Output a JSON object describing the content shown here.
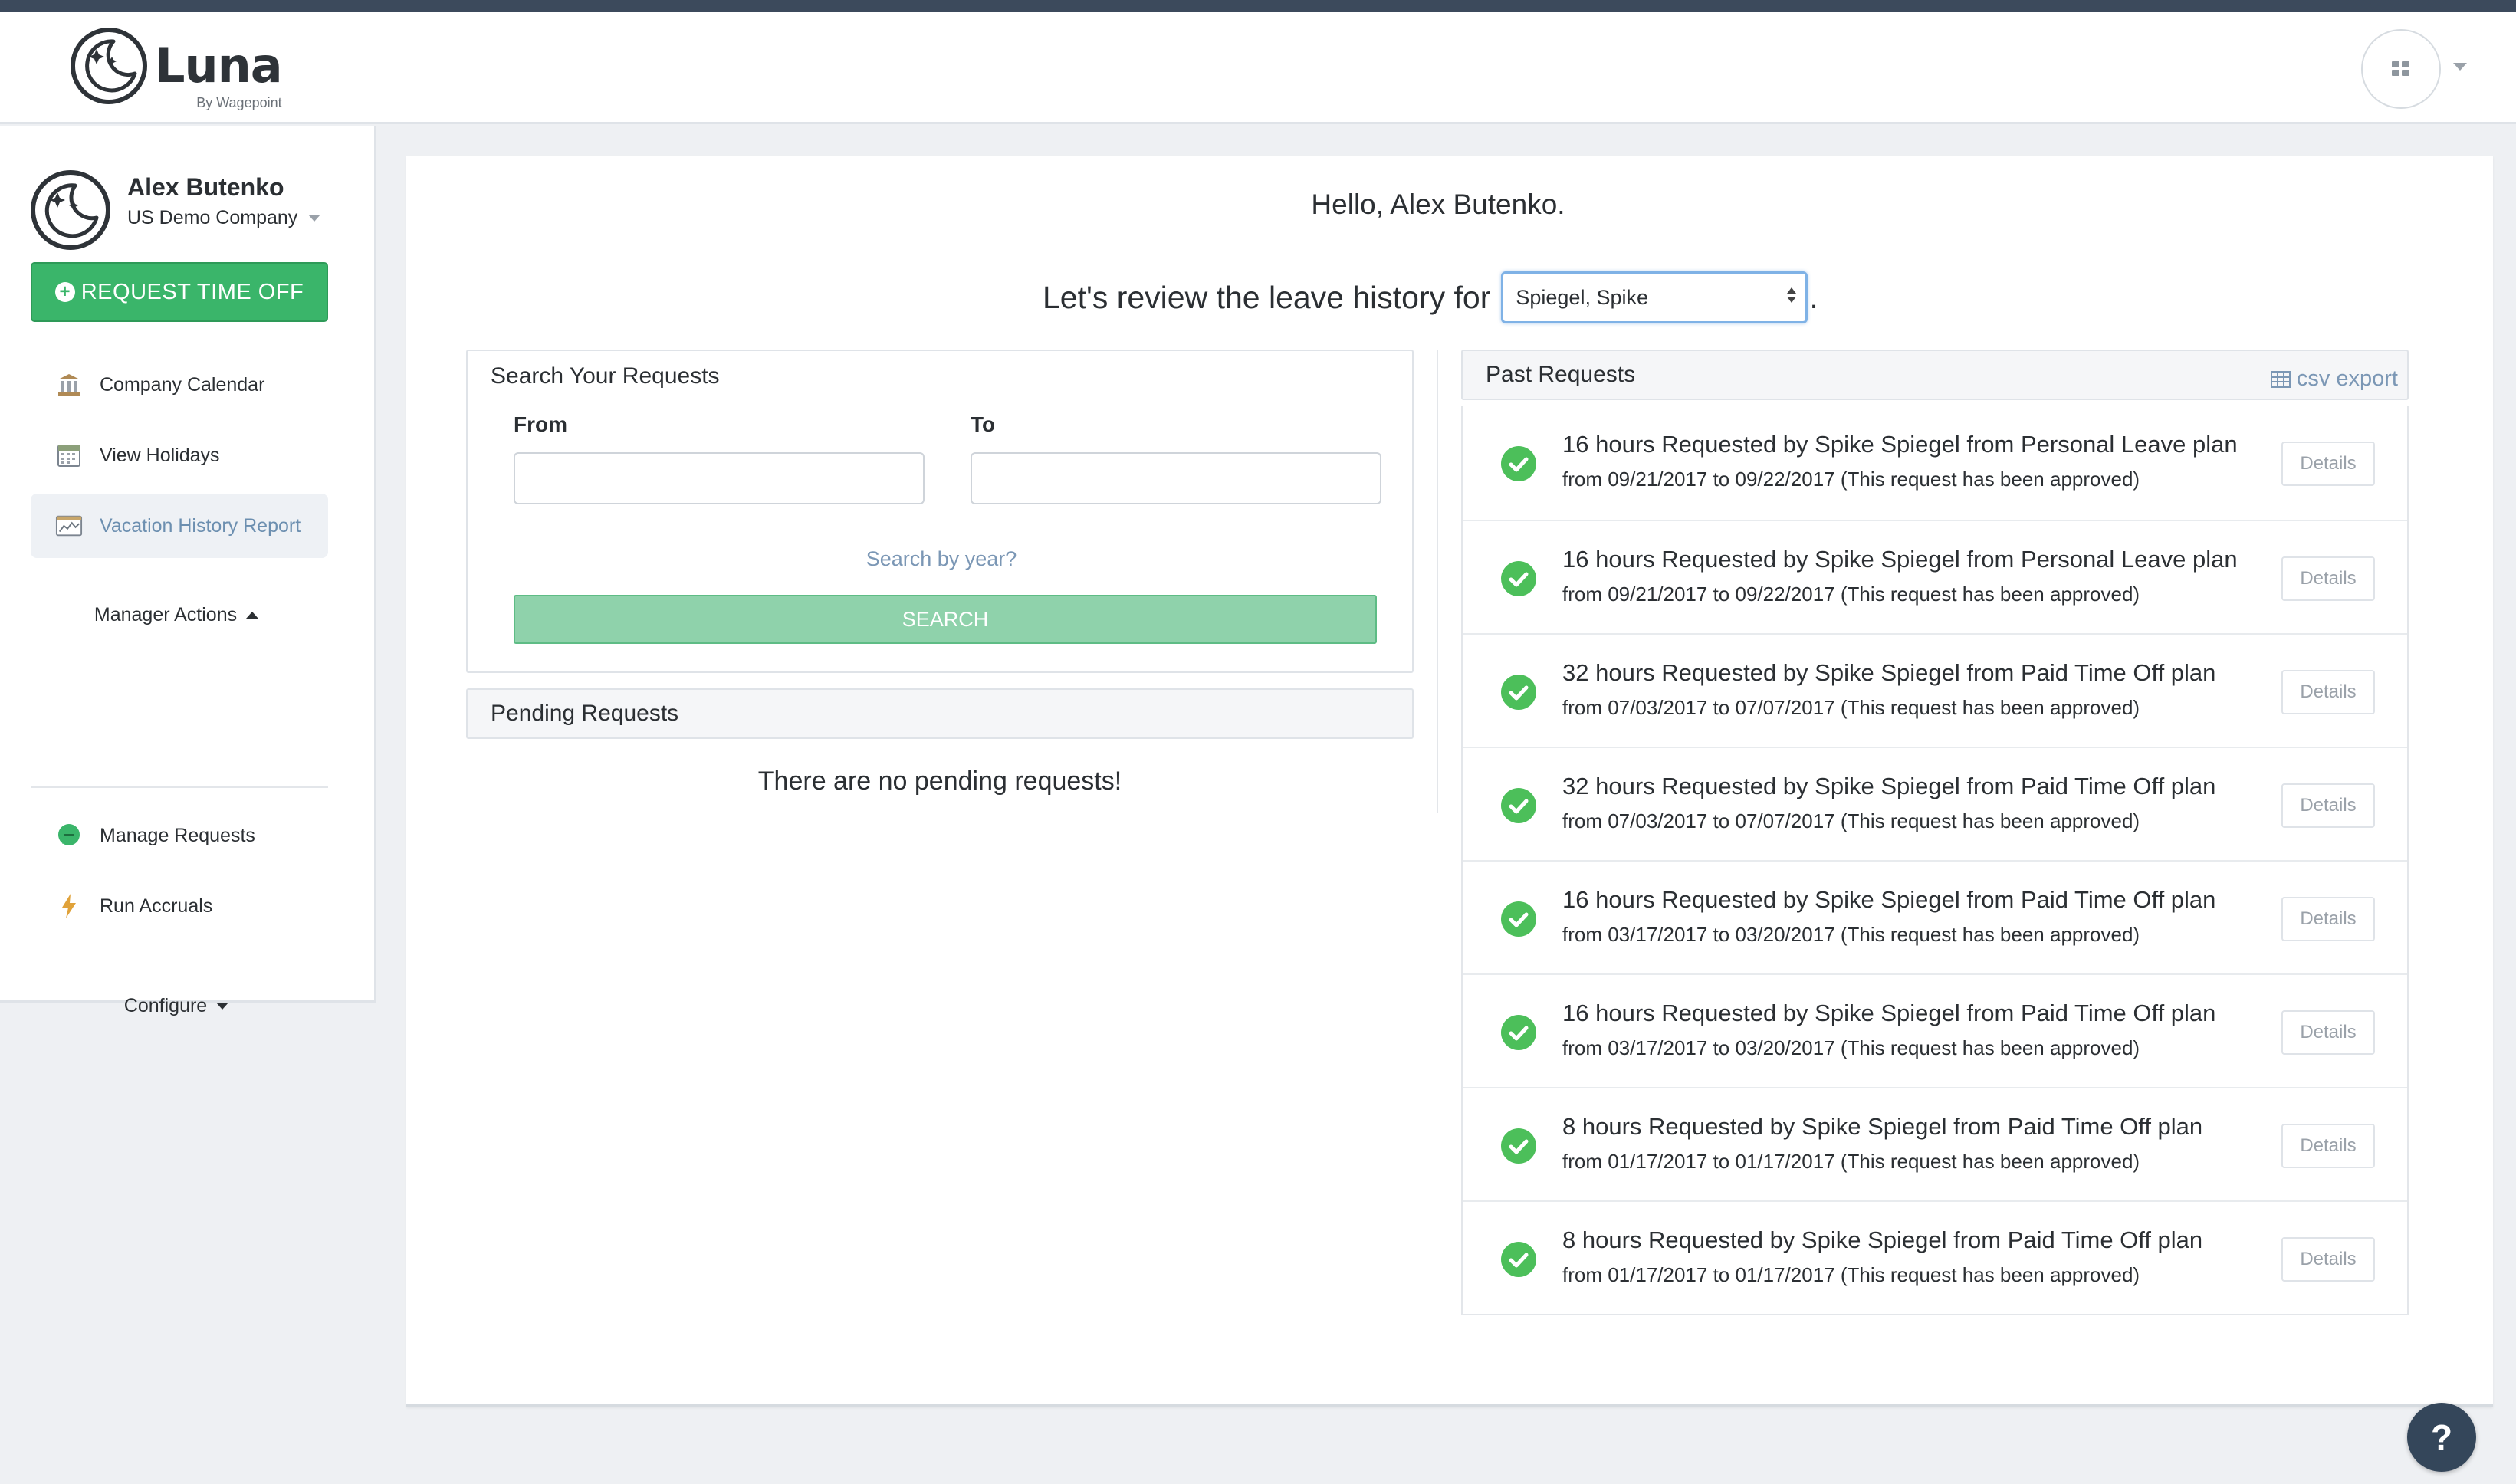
{
  "app": {
    "logo_name": "Luna",
    "logo_sub": "By Wagepoint"
  },
  "user": {
    "name": "Alex Butenko",
    "company": "US Demo Company"
  },
  "sidebar": {
    "request_button": "REQUEST TIME OFF",
    "items": [
      {
        "label": "Company Calendar",
        "icon": "bank-icon"
      },
      {
        "label": "View Holidays",
        "icon": "calendar-icon"
      },
      {
        "label": "Vacation History Report",
        "icon": "chart-icon"
      }
    ],
    "manager_actions_label": "Manager Actions",
    "manager_items": [
      {
        "label": "Manage Requests",
        "icon": "chat-icon"
      },
      {
        "label": "Run Accruals",
        "icon": "bolt-icon"
      }
    ],
    "configure_label": "Configure"
  },
  "main": {
    "greeting": "Hello, Alex Butenko.",
    "review_prefix": "Let's review the leave history for",
    "selected_employee": "Spiegel, Spike",
    "review_suffix": "."
  },
  "search": {
    "title": "Search Your Requests",
    "from_label": "From",
    "to_label": "To",
    "from_value": "",
    "to_value": "",
    "year_link": "Search by year?",
    "button": "SEARCH"
  },
  "pending": {
    "title": "Pending Requests",
    "empty_message": "There are no pending requests!"
  },
  "past": {
    "title": "Past Requests",
    "export_label": "csv export",
    "details_label": "Details",
    "requests": [
      {
        "title": "16 hours Requested by Spike Spiegel from Personal Leave plan",
        "sub": "from 09/21/2017 to 09/22/2017 (This request has been approved)"
      },
      {
        "title": "16 hours Requested by Spike Spiegel from Personal Leave plan",
        "sub": "from 09/21/2017 to 09/22/2017 (This request has been approved)"
      },
      {
        "title": "32 hours Requested by Spike Spiegel from Paid Time Off plan",
        "sub": "from 07/03/2017 to 07/07/2017 (This request has been approved)"
      },
      {
        "title": "32 hours Requested by Spike Spiegel from Paid Time Off plan",
        "sub": "from 07/03/2017 to 07/07/2017 (This request has been approved)"
      },
      {
        "title": "16 hours Requested by Spike Spiegel from Paid Time Off plan",
        "sub": "from 03/17/2017 to 03/20/2017 (This request has been approved)"
      },
      {
        "title": "16 hours Requested by Spike Spiegel from Paid Time Off plan",
        "sub": "from 03/17/2017 to 03/20/2017 (This request has been approved)"
      },
      {
        "title": "8 hours Requested by Spike Spiegel from Paid Time Off plan",
        "sub": "from 01/17/2017 to 01/17/2017 (This request has been approved)"
      },
      {
        "title": "8 hours Requested by Spike Spiegel from Paid Time Off plan",
        "sub": "from 01/17/2017 to 01/17/2017 (This request has been approved)"
      }
    ]
  },
  "help": {
    "label": "?"
  },
  "colors": {
    "primary_green": "#3ab56a",
    "search_green": "#8fd2ab",
    "link_blue": "#7b97b5",
    "top_stripe": "#3c4a5c",
    "help_button": "#34465a"
  }
}
